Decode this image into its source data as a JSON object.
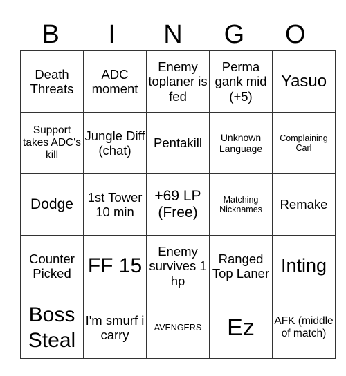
{
  "header": {
    "letters": [
      "B",
      "I",
      "N",
      "G",
      "O"
    ]
  },
  "board": {
    "rows": [
      [
        "Death Threats",
        "ADC moment",
        "Enemy toplaner is fed",
        "Perma gank mid (+5)",
        "Yasuo"
      ],
      [
        "Support takes ADC's kill",
        "Jungle Diff (chat)",
        "Pentakill",
        "Unknown Language",
        "Complaining Carl"
      ],
      [
        "Dodge",
        "1st Tower 10 min",
        "+69 LP (Free)",
        "Matching Nicknames",
        "Remake"
      ],
      [
        "Counter Picked",
        "FF 15",
        "Enemy survives 1 hp",
        "Ranged Top Laner",
        "Inting"
      ],
      [
        "Boss Steal",
        "I'm smurf i carry",
        "AVENGERS",
        "Ez",
        "AFK (middle of match)"
      ]
    ]
  }
}
